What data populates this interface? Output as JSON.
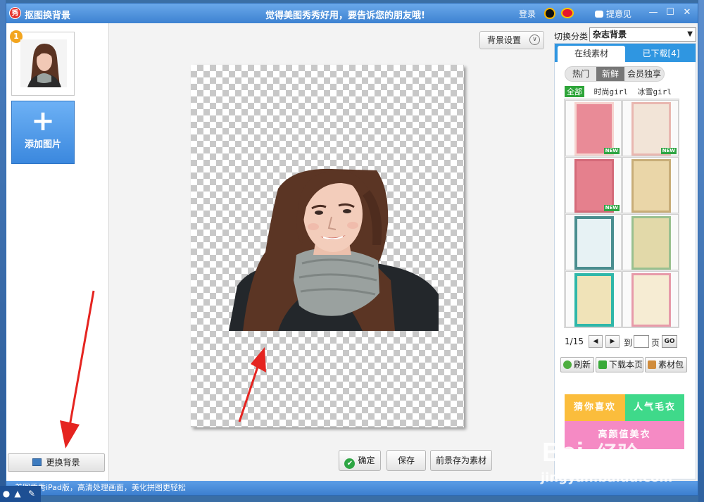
{
  "window": {
    "app_icon_text": "秀",
    "title": "抠图换背景",
    "slogan": "觉得美图秀秀好用，要告诉您的朋友哦!",
    "login": "登录",
    "feedback": "提意见",
    "minimize": "—",
    "maximize": "☐",
    "close": "✕"
  },
  "left": {
    "thumb_badge": "1",
    "add_plus": "+",
    "add_label": "添加图片",
    "change_bg_label": "更换背景"
  },
  "center": {
    "bg_settings_label": "背景设置",
    "bg_settings_chevron": "∨",
    "ok_label": "确定",
    "ok_check": "✔",
    "save_label": "保存",
    "save_fg_label": "前景存为素材"
  },
  "right": {
    "category_label": "切换分类",
    "category_value": "杂志背景",
    "tabs": [
      "在线素材",
      "已下载[4]"
    ],
    "subtabs": [
      "热门",
      "新鲜",
      "会员独享"
    ],
    "filters": [
      "全部",
      "时尚girl",
      "冰雪girl"
    ],
    "new_badge": "NEW",
    "pager": {
      "page": "1/15",
      "prev": "◀",
      "next": "▶",
      "to": "到",
      "page_suffix": "页",
      "go": "GO"
    },
    "tools": [
      "刷新",
      "下载本页",
      "素材包"
    ],
    "promos": [
      "猜你喜欢",
      "人气毛衣",
      "高颜值美衣"
    ]
  },
  "status": {
    "text": "美图秀秀iPad版，高清处理画面，美化拼图更轻松"
  },
  "watermark": {
    "brand": "Bai",
    "brand_cn": "经验",
    "url": "jingyan.baidu.com"
  },
  "colors": {
    "title_blue": "#3d82d1",
    "tab_blue": "#2f96e1",
    "confirm_green": "#2da543",
    "promo_yellow": "#fbbd3c",
    "promo_green": "#3fd98a",
    "promo_pink": "#f58ac4",
    "arrow_red": "#e52420"
  }
}
